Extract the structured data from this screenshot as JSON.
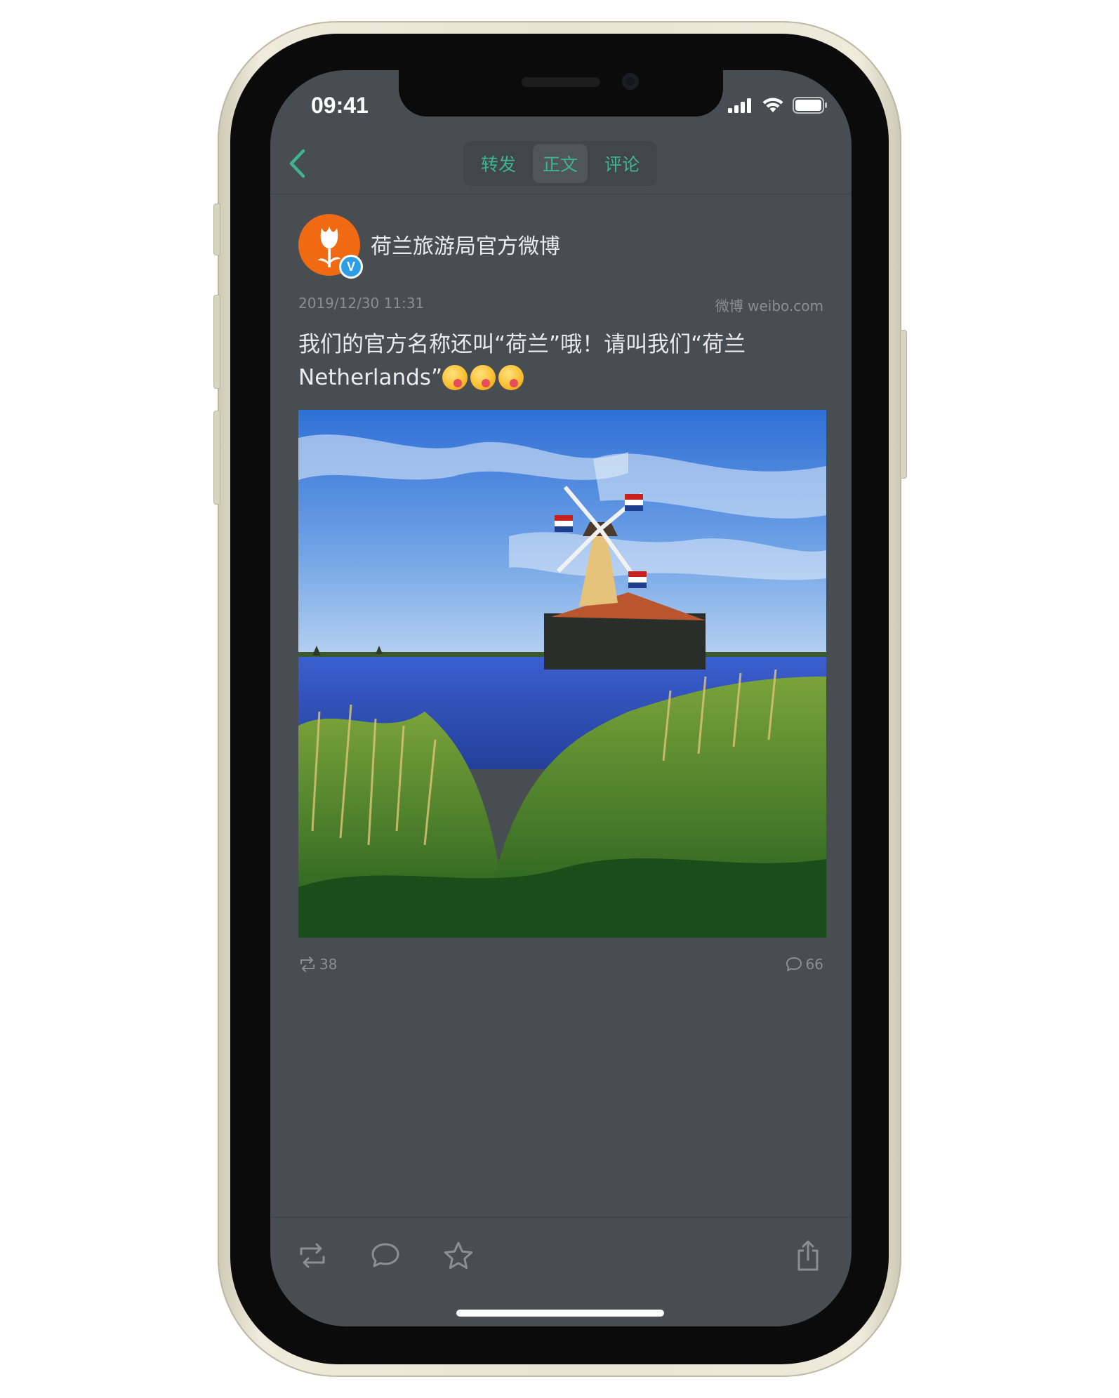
{
  "status_bar": {
    "time": "09:41"
  },
  "nav": {
    "tabs": [
      {
        "label": "转发",
        "active": false
      },
      {
        "label": "正文",
        "active": true
      },
      {
        "label": "评论",
        "active": false
      }
    ],
    "back_icon": "chevron-left-icon"
  },
  "post": {
    "author": "荷兰旅游局官方微博",
    "verified_label": "V",
    "timestamp": "2019/12/30 11:31",
    "source": "微博 weibo.com",
    "text": "我们的官方名称还叫“荷兰”哦！请叫我们“荷兰Netherlands”",
    "emoji_count": 3,
    "image_description": "windmill-landscape-photo",
    "repost_count": "38",
    "comment_count": "66"
  },
  "toolbar": {
    "icons": [
      "repost-icon",
      "comment-icon",
      "star-icon",
      "share-icon"
    ]
  },
  "colors": {
    "accent": "#3fb58f",
    "background": "#484d52",
    "secondary_text": "#8a8f94"
  }
}
